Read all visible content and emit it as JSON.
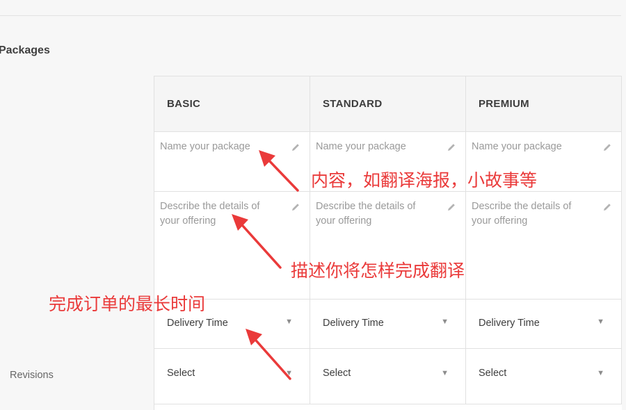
{
  "section": {
    "title": "Packages"
  },
  "tiers": [
    {
      "label": "BASIC"
    },
    {
      "label": "STANDARD"
    },
    {
      "label": "PREMIUM"
    }
  ],
  "fields": {
    "name_placeholder": "Name your package",
    "description_placeholder": "Describe the details of your offering",
    "delivery_time": "Delivery Time",
    "revisions_value": "Select"
  },
  "rows": {
    "revisions_label": "Revisions"
  },
  "annotations": {
    "name_note": "内容，如翻译海报，小故事等",
    "description_note": "描述你将怎样完成翻译",
    "delivery_note": "完成订单的最长时间"
  },
  "colors": {
    "annotation": "#ea3a3a",
    "border": "#e1e1e1",
    "header_bg": "#f5f5f5",
    "placeholder": "#9a9a9a"
  },
  "icons": [
    "pencil-icon",
    "caret-down-icon"
  ]
}
